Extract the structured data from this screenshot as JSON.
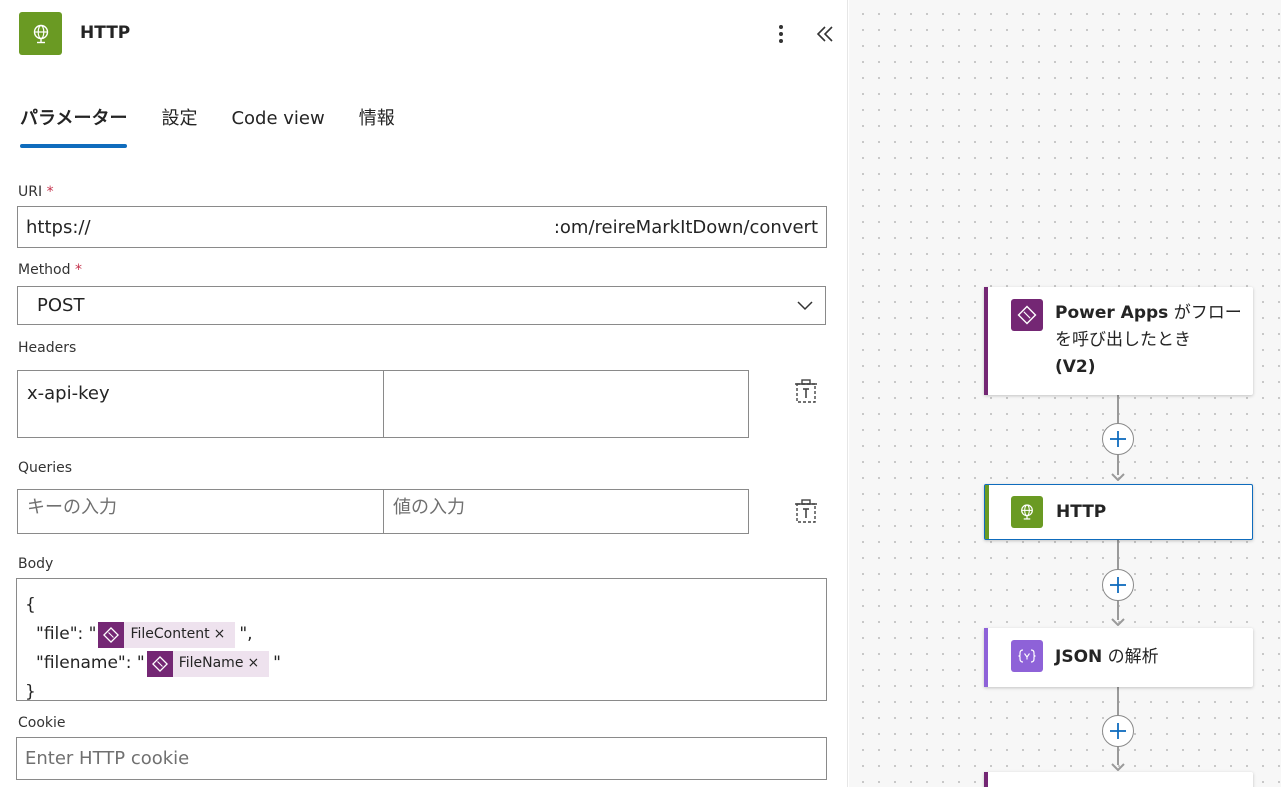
{
  "header": {
    "title": "HTTP",
    "icon": "globe-icon",
    "accent": "#6a9a23"
  },
  "tabs": [
    {
      "label": "パラメーター",
      "active": true
    },
    {
      "label": "設定",
      "active": false
    },
    {
      "label": "Code view",
      "active": false
    },
    {
      "label": "情報",
      "active": false
    }
  ],
  "uri": {
    "label": "URI",
    "required_mark": "*",
    "value_start": "https://",
    "value_end": ":om/reireMarkItDown/convert"
  },
  "method": {
    "label": "Method",
    "required_mark": "*",
    "value": "POST"
  },
  "headers": {
    "label": "Headers",
    "key": "x-api-key",
    "value": ""
  },
  "queries": {
    "label": "Queries",
    "key_placeholder": "キーの入力",
    "value_placeholder": "値の入力"
  },
  "body": {
    "label": "Body",
    "open_brace": "{",
    "close_brace": "}",
    "line1_prefix": "\"file\": \"",
    "line1_suffix": "\",",
    "line2_prefix": "\"filename\": \"",
    "line2_suffix": "\"",
    "token1": "FileContent",
    "token2": "FileName",
    "token_close": "×"
  },
  "cookie": {
    "label": "Cookie",
    "placeholder": "Enter HTTP cookie"
  },
  "flow": {
    "trigger": {
      "title_bold": "Power Apps",
      "title_rest1": " がフロー",
      "title_rest2": "を呼び出したとき",
      "title_bold2": "(V2)",
      "color": "#742774"
    },
    "http": {
      "title": "HTTP",
      "color": "#6a9a23"
    },
    "json": {
      "title_bold": "JSON",
      "title_rest": " の解析",
      "color": "#8e62d8"
    }
  }
}
